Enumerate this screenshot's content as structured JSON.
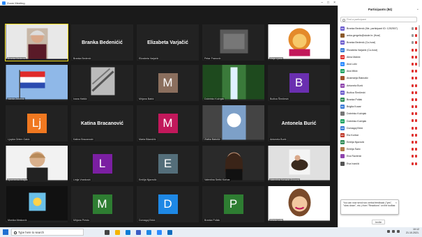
{
  "window": {
    "title": "Zoom Meeting"
  },
  "panel": {
    "title": "Participants (84)",
    "search_placeholder": "Find a participant",
    "participants": [
      {
        "initials": "BB",
        "name": "Branka Bedenić (Me, participant ID: 1252507)",
        "color": "#6a5acd"
      },
      {
        "initials": "",
        "name": "anka.gergelic@skole.hr (Host)",
        "color": "#8b5a2b"
      },
      {
        "initials": "BB",
        "name": "Branka Bedenić (Co-host)",
        "color": "#6a5acd"
      },
      {
        "initials": "EV",
        "name": "Elizabeta Varjačić (Co-host)",
        "color": "#3a7bd5"
      },
      {
        "initials": "AM",
        "name": "Alma Malnić",
        "color": "#e0312f"
      },
      {
        "initials": "AL",
        "name": "Ana Lulić",
        "color": "#2d8cff"
      },
      {
        "initials": "AM",
        "name": "Ana Mikić",
        "color": "#1aa260"
      },
      {
        "initials": "",
        "name": "Anamarija Blanušić",
        "color": "#a0522d"
      },
      {
        "initials": "AB",
        "name": "Antonela Burić",
        "color": "#8e44ad"
      },
      {
        "initials": "BŠ",
        "name": "Božica Šimičević",
        "color": "#6a5acd"
      },
      {
        "initials": "BP",
        "name": "Branka Pollak",
        "color": "#2e8b57"
      },
      {
        "initials": "BK",
        "name": "Brigita Kozari",
        "color": "#3a7bd5"
      },
      {
        "initials": "",
        "name": "Dobrinko Kožnjak",
        "color": "#777"
      },
      {
        "initials": "DK",
        "name": "Dobrinko Kožnjak",
        "color": "#1aa260"
      },
      {
        "initials": "DB",
        "name": "Domagoj Brkić",
        "color": "#3a7bd5"
      },
      {
        "initials": "EK",
        "name": "Ela Korbar",
        "color": "#c0392b"
      },
      {
        "initials": "EN",
        "name": "Emilija Njavrolić",
        "color": "#2e8b57"
      },
      {
        "initials": "",
        "name": "Emilija Šarić",
        "color": "#b07a4a"
      },
      {
        "initials": "",
        "name": "Ena Ravlenić",
        "color": "#8e44ad"
      },
      {
        "initials": "",
        "name": "Eva Ivančić",
        "color": "#555"
      }
    ]
  },
  "tooltip": {
    "text": "You can now send non-verbal feedback (\"yes\", \"slow down\", etc.) from \"Reactions\" on the toolbar.",
    "close": "×"
  },
  "invite_label": "Invite",
  "tiles": [
    {
      "name": "Branka Bedenić",
      "type": "photo",
      "photo": "woman",
      "active": true
    },
    {
      "name": "Branka Bedenić",
      "type": "bigname",
      "big": "Branka Bedenićić"
    },
    {
      "name": "Elizabeta Varjačić",
      "type": "bigname",
      "big": "Elizabeta Varjačić"
    },
    {
      "name": "Petar Franović",
      "type": "photo",
      "photo": "dark"
    },
    {
      "name": "Maja Ljubić",
      "type": "photo",
      "photo": "lion"
    },
    {
      "name": "Vanda Zečević",
      "type": "photo",
      "photo": "flag"
    },
    {
      "name": "Ivana Hatšić",
      "type": "photo",
      "photo": "bw"
    },
    {
      "name": "Mirjana Babić",
      "type": "avatar",
      "letter": "M",
      "color": "#8b6f5e"
    },
    {
      "name": "Dobrinko Kožnjak",
      "type": "photo",
      "photo": "waterfall"
    },
    {
      "name": "Božica Šimičević",
      "type": "avatar",
      "letter": "B",
      "color": "#6a2fb0"
    },
    {
      "name": "Ljupka Orlem Gakić",
      "type": "avatar",
      "letter": "Lj",
      "color": "#f07820"
    },
    {
      "name": "Katina Bracanović",
      "type": "bigname",
      "big": "Katina Bracanović"
    },
    {
      "name": "Marta Bilandžić",
      "type": "avatar",
      "letter": "M",
      "color": "#c2185b"
    },
    {
      "name": "Zlatka Batušić",
      "type": "photo",
      "photo": "light"
    },
    {
      "name": "Antonela Burić",
      "type": "bigname",
      "big": "Antonela Burić"
    },
    {
      "name": "Spomenka Brajda",
      "type": "photo",
      "photo": "woman2"
    },
    {
      "name": "Linija Vranković",
      "type": "avatar",
      "letter": "L",
      "color": "#7b1fa2"
    },
    {
      "name": "Emilija Njavrolić",
      "type": "avatar",
      "letter": "E",
      "color": "#546e7a"
    },
    {
      "name": "Valentina Sertić Korbar",
      "type": "photo",
      "photo": "woman3"
    },
    {
      "name": "Valentina Kovačić Zivković",
      "type": "photo",
      "photo": "dog"
    },
    {
      "name": "Monika Mesković",
      "type": "photo",
      "photo": "cartoon"
    },
    {
      "name": "Mirjana Presto",
      "type": "avatar",
      "letter": "M",
      "color": "#2e7d32"
    },
    {
      "name": "Domagoj Brkić",
      "type": "avatar",
      "letter": "D",
      "color": "#1e88e5"
    },
    {
      "name": "Branka Pollak",
      "type": "avatar",
      "letter": "P",
      "color": "#2e7d32"
    },
    {
      "name": "Mirela Lulić",
      "type": "photo",
      "photo": "cartoon2"
    }
  ],
  "taskbar": {
    "search_placeholder": "Type here to search",
    "time": "10:12",
    "date": "21.10.2021."
  },
  "colors": {
    "active_outline": "#f5e11f",
    "zoom_blue": "#2d8cff"
  }
}
